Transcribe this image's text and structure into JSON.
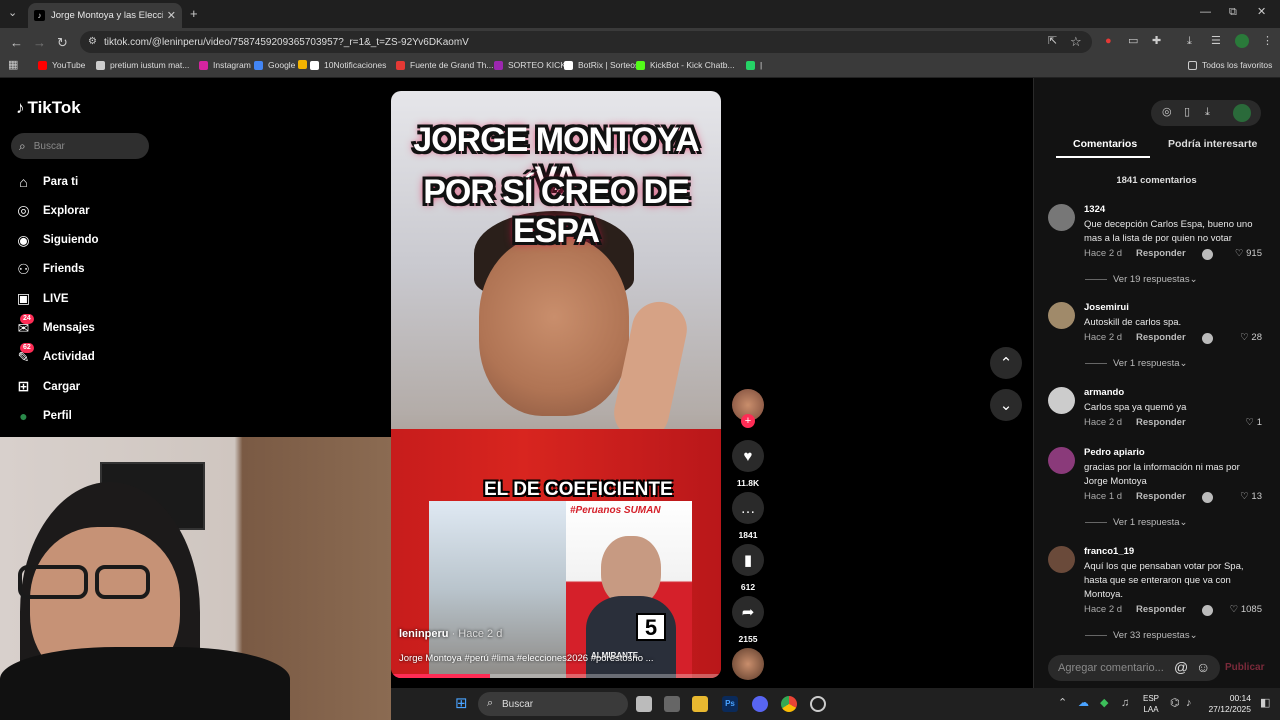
{
  "browser": {
    "tab_title": "Jorge Montoya y las Elecciones",
    "new_tab": "+",
    "url": "tiktok.com/@leninperu/video/7587459209365703957?_r=1&_t=ZS-92Yv6DKaomV",
    "bookmarks": [
      {
        "label": "YouTube",
        "color": "#ff0000"
      },
      {
        "label": "pretium iustum mat...",
        "color": "#cccccc"
      },
      {
        "label": "Instagram",
        "color": "#d6249f"
      },
      {
        "label": "Google",
        "color": "#4285f4"
      },
      {
        "label": "",
        "color": "#f4b400"
      },
      {
        "label": "10Notificaciones",
        "color": "#ffffff"
      },
      {
        "label": "Fuente de Grand Th...",
        "color": "#e53935"
      },
      {
        "label": "SORTEO KICK",
        "color": "#9c27b0"
      },
      {
        "label": "BotRix | Sorteos",
        "color": "#ffffff"
      },
      {
        "label": "KickBot - Kick Chatb...",
        "color": "#53fc18"
      },
      {
        "label": "|",
        "color": "#25d366"
      }
    ],
    "all_favorites": "Todos los favoritos"
  },
  "tiktok": {
    "logo": "TikTok",
    "search_placeholder": "Buscar",
    "nav": [
      {
        "label": "Para ti",
        "icon": "home-icon"
      },
      {
        "label": "Explorar",
        "icon": "compass-icon"
      },
      {
        "label": "Siguiendo",
        "icon": "following-icon"
      },
      {
        "label": "Friends",
        "icon": "friends-icon"
      },
      {
        "label": "LIVE",
        "icon": "live-icon"
      },
      {
        "label": "Mensajes",
        "icon": "messages-icon",
        "badge": "24"
      },
      {
        "label": "Actividad",
        "icon": "activity-icon",
        "badge": "62"
      },
      {
        "label": "Cargar",
        "icon": "upload-icon"
      },
      {
        "label": "Perfil",
        "icon": "profile-icon"
      }
    ]
  },
  "video": {
    "title_line1": "JORGE MONTOYA VA",
    "title_line2": "POR SÍ CREO DE ESPA",
    "caption_overlay": "EL DE COEFICIENTE",
    "poster_tag": "#Peruanos SUMAN",
    "poster_name": "ALMIRANTE",
    "poster_number": "5",
    "author": "leninperu",
    "time": " · Hace 2 d",
    "description": "Jorge Montoya #perú #lima #elecciones2026 #porestosno ...",
    "progress": 0.3,
    "likes": "11.8K",
    "comments": "1841",
    "saves": "612",
    "shares": "2155"
  },
  "panel": {
    "tab_comments": "Comentarios",
    "tab_interest": "Podría interesarte",
    "count": "1841 comentarios",
    "reply_label": "Responder",
    "comments": [
      {
        "user": "1324",
        "text": "Que decepción Carlos Espa, bueno uno mas a la lista de por quien no votar",
        "time": "Hace 2 d",
        "likes": "915",
        "more": "Ver 19 respuestas",
        "avatar": "#777777"
      },
      {
        "user": "Josemirui",
        "text": "Autoskill de carlos spa.",
        "time": "Hace 2 d",
        "likes": "28",
        "more": "Ver 1 respuesta",
        "avatar": "#a08a6a"
      },
      {
        "user": "armando",
        "text": "Carlos spa ya quemó ya",
        "time": "Hace 2 d",
        "likes": "1",
        "more": "",
        "avatar": "#cccccc"
      },
      {
        "user": "Pedro apiario",
        "text": "gracias por la información ni mas por Jorge Montoya",
        "time": "Hace 1 d",
        "likes": "13",
        "more": "Ver 1 respuesta",
        "avatar": "#8a3a7a"
      },
      {
        "user": "franco1_19",
        "text": "Aquí los que pensaban votar por Spa, hasta que se enteraron que va con Montoya.",
        "time": "Hace 2 d",
        "likes": "1085",
        "more": "Ver 33 respuestas",
        "avatar": "#6a4a3a"
      }
    ],
    "add_comment": "Agregar comentario...",
    "publish": "Publicar"
  },
  "taskbar": {
    "search": "Buscar",
    "lang1": "ESP",
    "lang2": "LAA",
    "time": "00:14",
    "date": "27/12/2025"
  }
}
